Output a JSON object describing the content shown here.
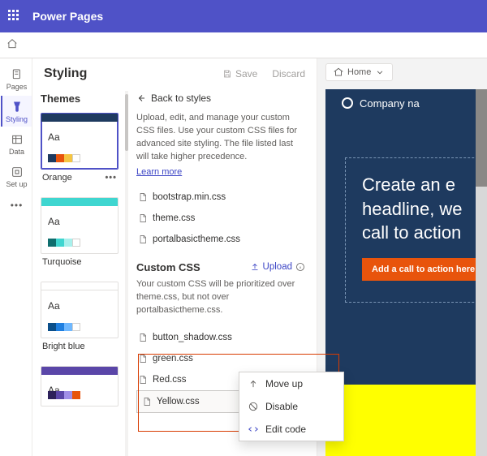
{
  "appbar": {
    "title": "Power Pages"
  },
  "rail": {
    "items": [
      {
        "key": "pages",
        "label": "Pages"
      },
      {
        "key": "styling",
        "label": "Styling"
      },
      {
        "key": "data",
        "label": "Data"
      },
      {
        "key": "setup",
        "label": "Set up"
      }
    ],
    "active": "styling"
  },
  "panel": {
    "title": "Styling",
    "save_label": "Save",
    "discard_label": "Discard"
  },
  "themes": {
    "title": "Themes",
    "cards": [
      {
        "name": "Orange",
        "top": "#1e3a5f",
        "swatches": [
          "#1e3a5f",
          "#e8540c",
          "#f5c542",
          "#ffffff"
        ],
        "selected": true,
        "more": true
      },
      {
        "name": "Turquoise",
        "top": "#3fd6d0",
        "swatches": [
          "#0f6e6e",
          "#3fd6d0",
          "#a8f0ec",
          "#ffffff"
        ],
        "selected": false,
        "more": false
      },
      {
        "name": "Bright blue",
        "top": "#ffffff",
        "topBorder": true,
        "swatches": [
          "#0b4f8a",
          "#1f7fe0",
          "#6fb8ff",
          "#ffffff"
        ],
        "selected": false,
        "more": false
      },
      {
        "name": "",
        "top": "#5a46a8",
        "swatches": [
          "#2d215a",
          "#5a46a8",
          "#a08fe8",
          "#e8540c"
        ],
        "selected": false,
        "more": false,
        "partial": true
      }
    ]
  },
  "css": {
    "back_label": "Back to styles",
    "help_text": "Upload, edit, and manage your custom CSS files. Use your custom CSS files for advanced site styling. The file listed last will take higher precedence.",
    "learn_more": "Learn more",
    "system_files": [
      "bootstrap.min.css",
      "theme.css",
      "portalbasictheme.css"
    ],
    "custom_title": "Custom CSS",
    "upload_label": "Upload",
    "custom_help": "Your custom CSS will be prioritized over theme.css, but not over portalbasictheme.css.",
    "custom_files": [
      "button_shadow.css",
      "green.css",
      "Red.css",
      "Yellow.css"
    ],
    "selected_file_index": 3,
    "menu": {
      "move_up": "Move up",
      "disable": "Disable",
      "edit_code": "Edit code"
    }
  },
  "preview": {
    "breadcrumb": "Home",
    "company": "Company na",
    "hero_lines": [
      "Create an e",
      "headline, we",
      "call to action"
    ],
    "cta_label": "Add a call to action here"
  },
  "colors": {
    "brand": "#4f52c7",
    "accent": "#e8540c"
  }
}
